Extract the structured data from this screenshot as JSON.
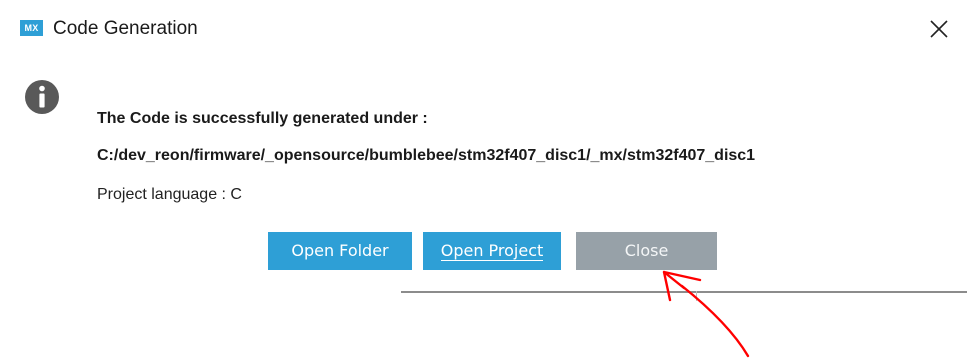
{
  "window": {
    "app_icon_text": "MX",
    "title": "Code Generation",
    "close_icon": "close-x-icon"
  },
  "dialog": {
    "info_icon": "info-icon",
    "message_heading": "The Code is successfully generated under :",
    "path": "C:/dev_reon/firmware/_opensource/bumblebee/stm32f407_disc1/_mx/stm32f407_disc1",
    "language": "Project language : C"
  },
  "buttons": {
    "open_folder": "Open Folder",
    "open_project": "Open Project",
    "close": "Close"
  },
  "colors": {
    "primary_button": "#2e9fd6",
    "close_button": "#97a1a8",
    "annotation_arrow": "#ff0000"
  }
}
